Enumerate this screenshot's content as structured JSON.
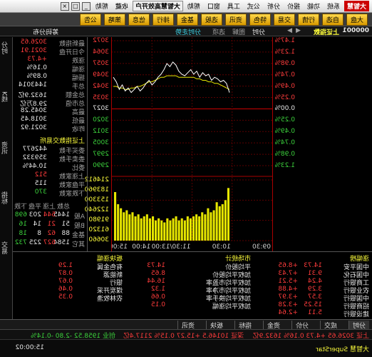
{
  "menu": {
    "logo": "大智慧",
    "items": [
      "系统",
      "功能",
      "报价",
      "分析",
      "公式",
      "工具",
      "窗口",
      "帮助"
    ],
    "brand": "大智慧高效开户",
    "right_items": [
      "收藏",
      "帮助"
    ],
    "window_buttons": [
      "_",
      "□",
      "×"
    ]
  },
  "toolbar": {
    "buttons": [
      "大盘",
      "自选",
      "行情",
      "交易",
      "特色",
      "资讯",
      "选股",
      "基金",
      "排行",
      "信息",
      "策略",
      "公告",
      "新闻"
    ]
  },
  "titlebar": {
    "code": "000001",
    "name": "上证指数",
    "nav": [
      "◀",
      "▶",
      "分时",
      "图解",
      "选项",
      "分时走势"
    ],
    "right": "筹码分布"
  },
  "chart_data": {
    "type": "line",
    "title": "",
    "price_axis": {
      "left": [
        "1.47%",
        "1.23%",
        "0.98%",
        "0.74%",
        "0.49%",
        "0.25%",
        "0.00%",
        "0.25%",
        "0.49%",
        "0.74%",
        "0.98%",
        "1.23%"
      ],
      "right": [
        "3072",
        "3064",
        "3057",
        "3049",
        "3042",
        "3035",
        "3027",
        "3020",
        "3012",
        "3005",
        "2997",
        "2990"
      ]
    },
    "volume_axis": {
      "right": [
        "214612",
        "183960",
        "153300",
        "122640",
        "91980",
        "61320",
        "30660"
      ]
    },
    "time_labels": [
      "09:30",
      "10:30",
      "11:30/13:00",
      "14:00",
      "15:00"
    ],
    "price_line": [
      3038,
      3044,
      3046,
      3045,
      3047,
      3048,
      3046,
      3050,
      3049,
      3051,
      3048,
      3052,
      3050,
      3053,
      3051,
      3049,
      3050,
      3052,
      3056,
      3058,
      3055,
      3057,
      3053,
      3050,
      3048,
      3045,
      3043,
      3046,
      3044,
      3041,
      3039,
      3042,
      3040,
      3038,
      3041,
      3039,
      3043,
      3040,
      3045,
      3048
    ],
    "avg_line": [
      3040,
      3041,
      3042,
      3043,
      3044,
      3044,
      3045,
      3045,
      3046,
      3046,
      3047,
      3047,
      3048,
      3048,
      3048,
      3048,
      3048,
      3048,
      3049,
      3049,
      3049,
      3049,
      3048,
      3048,
      3047,
      3046,
      3045,
      3045,
      3044,
      3043,
      3042,
      3042,
      3041,
      3041,
      3040,
      3040,
      3041,
      3041,
      3042,
      3042
    ],
    "volume": [
      26,
      20,
      18,
      17,
      19,
      15,
      14,
      16,
      13,
      14,
      12,
      13,
      12,
      11,
      12,
      10,
      11,
      10,
      12,
      11,
      10,
      11,
      9,
      10,
      11,
      10,
      12,
      11,
      13,
      12,
      11,
      13,
      12,
      14,
      13,
      15,
      14,
      16,
      18,
      24
    ]
  },
  "left_panel": {
    "rows": [
      {
        "label": "最新指数",
        "value": "3026.65"
      },
      {
        "label": "今日开盘",
        "value": "3021.91"
      },
      {
        "label": "涨跌",
        "value": "+4.73"
      },
      {
        "label": "涨幅",
        "value": "0.16%"
      },
      {
        "label": "振幅",
        "value": "0.89%"
      },
      {
        "label": "总手",
        "value": "1443014"
      },
      {
        "label": "总金额",
        "value": "1632.9亿"
      },
      {
        "label": "总市值",
        "value": "29.8万亿"
      },
      {
        "label": "最高",
        "value": "3045.28"
      },
      {
        "label": "最低",
        "value": "3018.45"
      },
      {
        "label": "昨收",
        "value": "3021.92"
      }
    ],
    "section_title": "上证指数交易所",
    "rows2": [
      {
        "label": "委买手数",
        "value": "442677"
      },
      {
        "label": "委卖手数",
        "value": "359332"
      },
      {
        "label": "委比",
        "value": "10.44%"
      },
      {
        "label": "上涨家数",
        "value": "512"
      },
      {
        "label": "平盘家数",
        "value": "115"
      },
      {
        "label": "下跌家数",
        "value": "370"
      }
    ],
    "grid_header": [
      "总数",
      "上涨",
      "平盘",
      "下跌"
    ],
    "grid": [
      {
        "label": "A股",
        "values": [
          "1445",
          "544",
          "203",
          "698"
        ]
      },
      {
        "label": "B股",
        "values": [
          "51",
          "21",
          "14",
          "16"
        ]
      },
      {
        "label": "基金",
        "values": [
          "88",
          "62",
          "8",
          "18"
        ]
      },
      {
        "label": "其它",
        "values": [
          "1584",
          "627",
          "225",
          "732"
        ]
      }
    ]
  },
  "bottom": {
    "left_title": "涨幅榜",
    "left_rows": [
      {
        "name": "中国平安",
        "a": "14.73",
        "b": "+8.65"
      },
      {
        "name": "中国石化",
        "a": "9.31",
        "b": "+7.43"
      },
      {
        "name": "工商银行",
        "a": "4.24",
        "b": "+5.21"
      },
      {
        "name": "农业银行",
        "a": "3.29",
        "b": "+4.88"
      },
      {
        "name": "中国银行",
        "a": "3.57",
        "b": "+3.97"
      },
      {
        "name": "招商银行",
        "a": "15.25",
        "b": "+3.28"
      },
      {
        "name": "建设银行",
        "a": "5.11",
        "b": "+2.64"
      }
    ],
    "mid_title": "市场统计",
    "mid_rows": [
      {
        "name": "平均股价",
        "v": "14.73"
      },
      {
        "name": "加权平均股价",
        "v": "8.65"
      },
      {
        "name": "加权平均市盈率",
        "v": "16.44"
      },
      {
        "name": "加权平均市净率",
        "v": "1.32"
      },
      {
        "name": "加权平均换手率",
        "v": "0.66"
      },
      {
        "name": "加权平均涨幅",
        "v": "0.15"
      }
    ],
    "right_title": "板块涨幅",
    "right_rows": [
      {
        "name": "有色金属",
        "v": "1.29"
      },
      {
        "name": "新能源",
        "v": "0.87"
      },
      {
        "name": "银行",
        "v": "0.67"
      },
      {
        "name": "煤炭开采",
        "v": "0.46"
      },
      {
        "name": "农林牧渔",
        "v": "0.35"
      }
    ]
  },
  "tabs": [
    "分时",
    "成交",
    "分价",
    "资金",
    "指标",
    "板块",
    "资讯"
  ],
  "vtabs": [
    "分时",
    "K线",
    "资讯",
    "指标",
    "交易"
  ],
  "status": {
    "index1": "上证 3026.65 +4.73 0.16% 1632.9亿",
    "index2": "深证 10146.5 +15.27 0.15% 2117.4亿",
    "index3": "创业 1958.52 -2.80 -0.14%",
    "brand": "大智慧 SuperStar",
    "time": "15:00:02"
  }
}
